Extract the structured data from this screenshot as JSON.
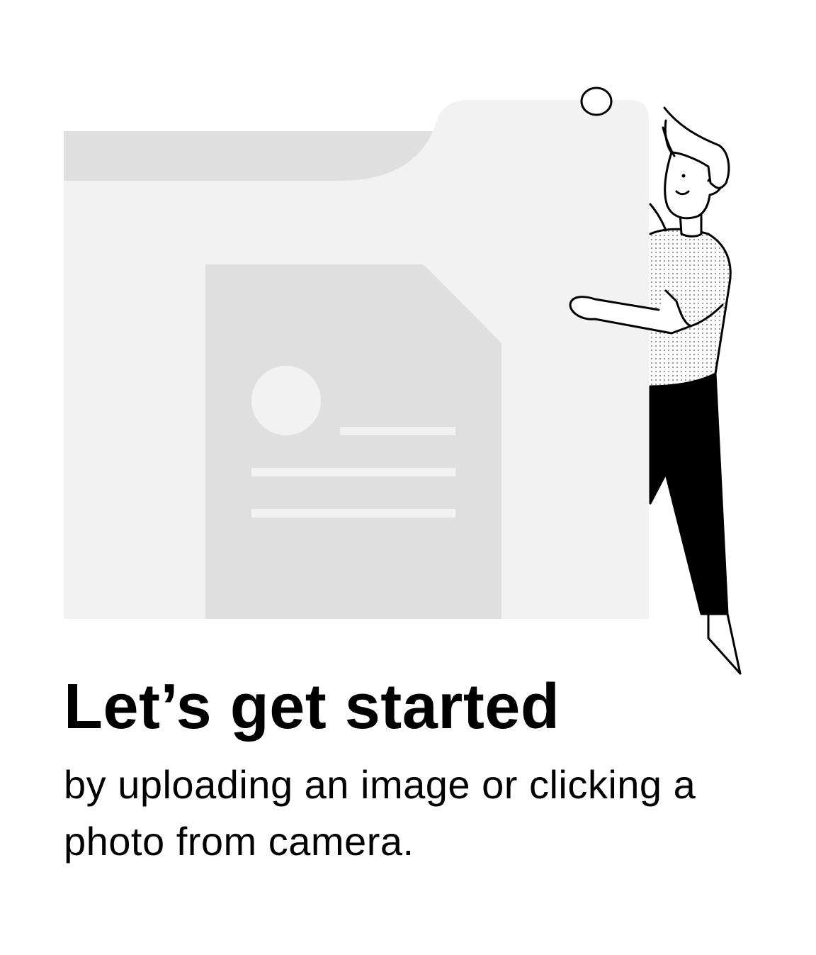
{
  "empty_state": {
    "title": "Let’s get started",
    "description": "by uploading an image or clicking a photo from camera."
  },
  "illustration": {
    "icon": "person-holding-folder-illustration",
    "colors": {
      "folder_tab": "#dfdfdf",
      "folder_body": "#f2f2f2",
      "document": "#dfdfdf",
      "document_content": "#f2f2f2",
      "ink": "#000000"
    }
  }
}
